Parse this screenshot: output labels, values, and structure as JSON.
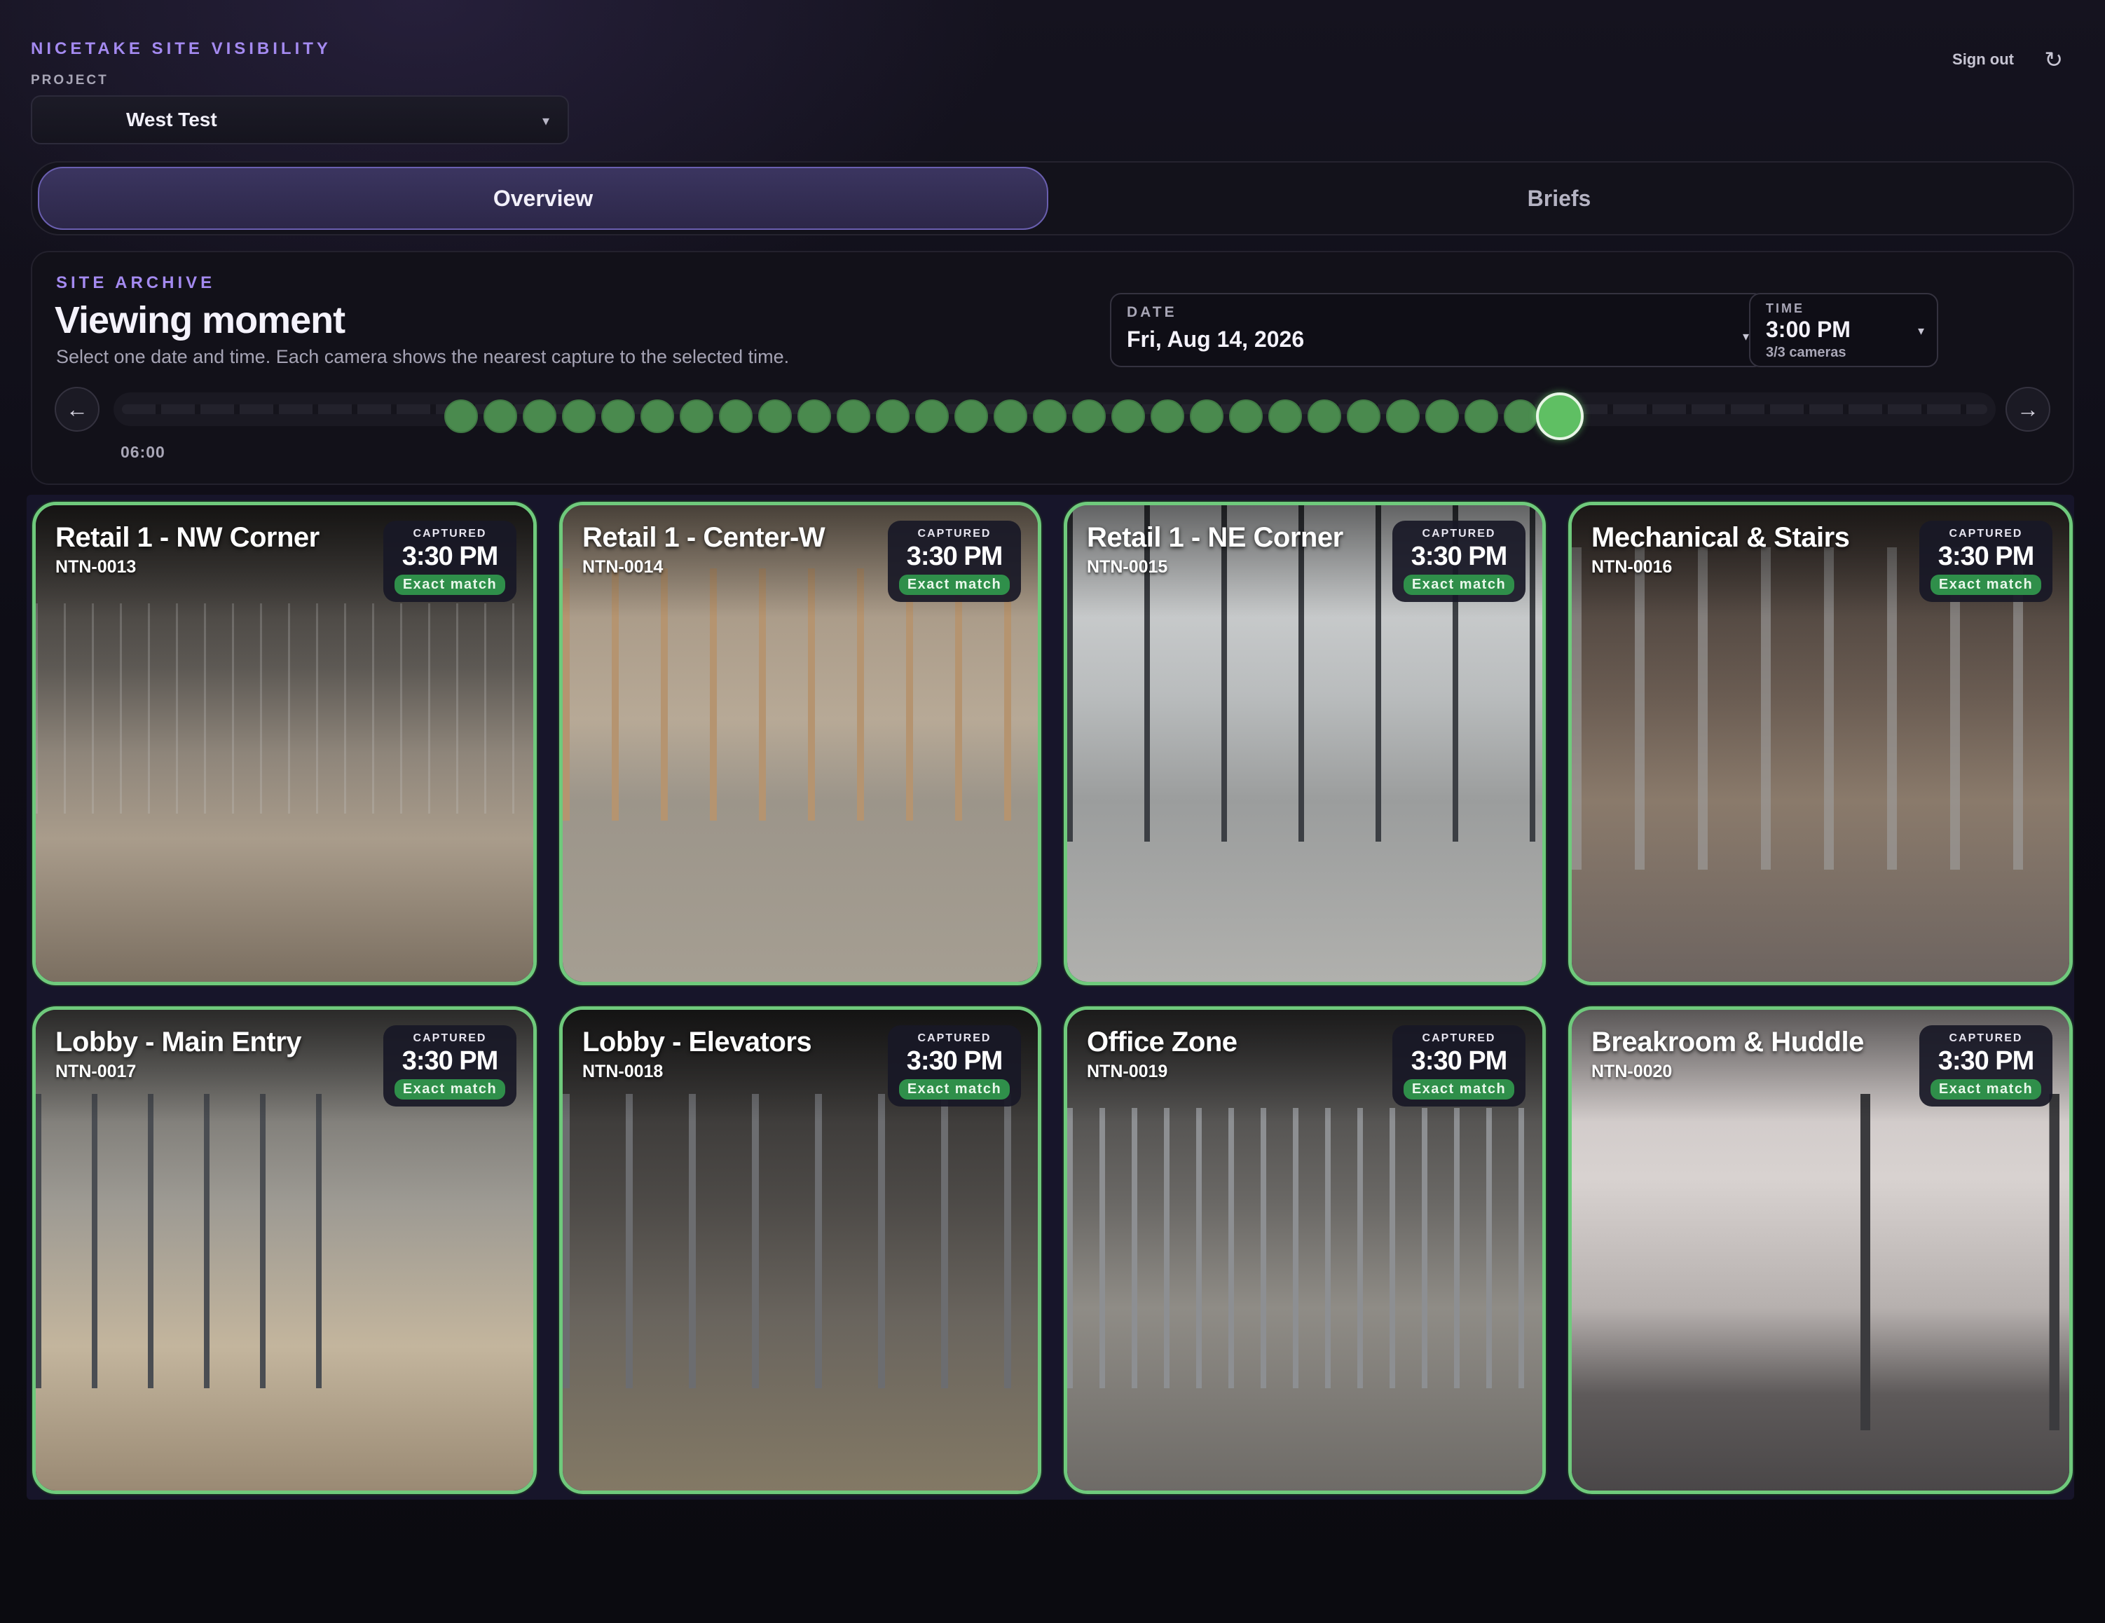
{
  "header": {
    "brand": "NICETAKE SITE VISIBILITY",
    "project_label": "PROJECT",
    "project_value": "West Test",
    "sign_out": "Sign out",
    "refresh_icon": "↻"
  },
  "tabs": [
    {
      "label": "Overview",
      "active": true
    },
    {
      "label": "Briefs",
      "active": false
    }
  ],
  "archive": {
    "label": "SITE ARCHIVE",
    "title": "Viewing moment",
    "subtitle": "Select one date and time. Each camera shows the nearest capture to the selected time.",
    "date_label": "DATE",
    "date_value": "Fri, Aug 14, 2026",
    "time_label": "TIME",
    "time_value": "3:00 PM",
    "camera_count": "3/3 cameras",
    "start_tick": "06:00",
    "prev_icon": "←",
    "next_icon": "→",
    "caret_icon": "▾",
    "timeline": {
      "capture_slots": 29,
      "selected_index": 28
    }
  },
  "badge": {
    "captured_label": "CAPTURED",
    "match_label": "Exact match"
  },
  "colors": {
    "accent": "#a48af0",
    "match_green": "#2f8f4a",
    "card_border": "#6fca7c",
    "timeline_dot": "#4a8a4e"
  },
  "cameras": [
    {
      "name": "Retail 1 - NW Corner",
      "id": "NTN-0013",
      "time": "3:30 PM"
    },
    {
      "name": "Retail 1 - Center-W",
      "id": "NTN-0014",
      "time": "3:30 PM"
    },
    {
      "name": "Retail 1 - NE Corner",
      "id": "NTN-0015",
      "time": "3:30 PM"
    },
    {
      "name": "Mechanical & Stairs",
      "id": "NTN-0016",
      "time": "3:30 PM"
    },
    {
      "name": "Lobby - Main Entry",
      "id": "NTN-0017",
      "time": "3:30 PM"
    },
    {
      "name": "Lobby - Elevators",
      "id": "NTN-0018",
      "time": "3:30 PM"
    },
    {
      "name": "Office Zone",
      "id": "NTN-0019",
      "time": "3:30 PM"
    },
    {
      "name": "Breakroom & Huddle",
      "id": "NTN-0020",
      "time": "3:30 PM"
    }
  ]
}
